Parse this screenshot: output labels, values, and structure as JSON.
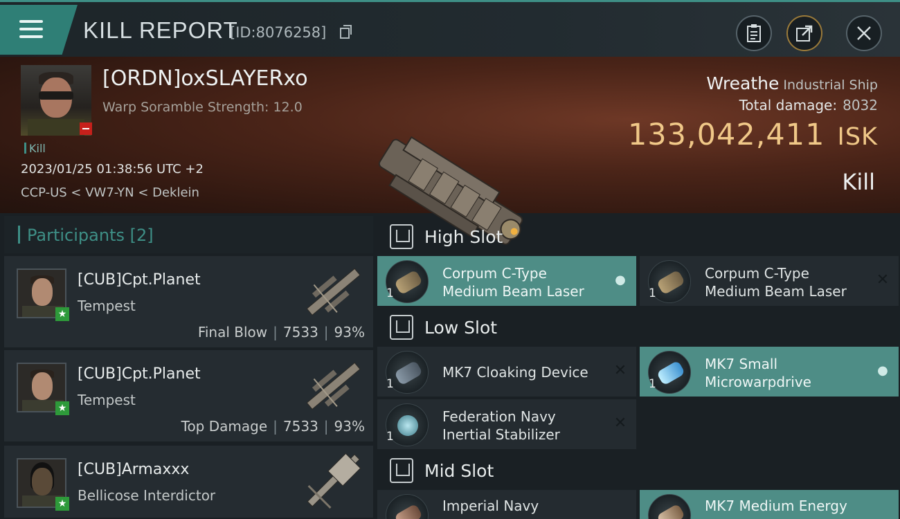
{
  "header": {
    "title": "KILL REPORT",
    "id_text": "[ID:8076258]",
    "icons": [
      "menu-icon",
      "copy-icon",
      "clipboard-icon",
      "share-icon",
      "close-icon"
    ]
  },
  "victim": {
    "pilot": "[ORDN]oxSLAYERxo",
    "warp": "Warp Soramble Strength: 12.0",
    "tag": "Kill",
    "datetime": "2023/01/25 01:38:56 UTC +2",
    "location": "CCP-US < VW7-YN < Deklein",
    "ship": "Wreathe",
    "ship_class": "Industrial Ship",
    "damage_label": "Total damage:",
    "damage_value": "8032",
    "isk_value": "133,042,411",
    "isk_unit": "ISK",
    "result": "Kill"
  },
  "participants": {
    "heading": "Participants [2]",
    "items": [
      {
        "name": "[CUB]Cpt.Planet",
        "ship": "Tempest",
        "role": "Final Blow",
        "damage": "7533",
        "percent": "93%"
      },
      {
        "name": "[CUB]Cpt.Planet",
        "ship": "Tempest",
        "role": "Top Damage",
        "damage": "7533",
        "percent": "93%"
      },
      {
        "name": "[CUB]Armaxxx",
        "ship": "Bellicose Interdictor"
      }
    ]
  },
  "slots": {
    "high": {
      "label": "High Slot",
      "modules": [
        {
          "line1": "Corpum C-Type",
          "line2": "Medium Beam Laser",
          "qty": "1"
        },
        {
          "line1": "Corpum C-Type",
          "line2": "Medium Beam Laser",
          "qty": "1"
        }
      ]
    },
    "low": {
      "label": "Low Slot",
      "modules": [
        {
          "line1": "MK7 Cloaking Device",
          "qty": "1"
        },
        {
          "line1": "MK7 Small",
          "line2": "Microwarpdrive",
          "qty": "1"
        },
        {
          "line1": "Federation Navy",
          "line2": "Inertial Stabilizer",
          "qty": "1"
        }
      ]
    },
    "mid": {
      "label": "Mid Slot",
      "modules": [
        {
          "line1": "Imperial Navy"
        },
        {
          "line1": "MK7 Medium Energy"
        }
      ]
    }
  },
  "colors": {
    "accent": "#3e8f86",
    "isk": "#f0c888",
    "active_module": "#4e8d86"
  }
}
